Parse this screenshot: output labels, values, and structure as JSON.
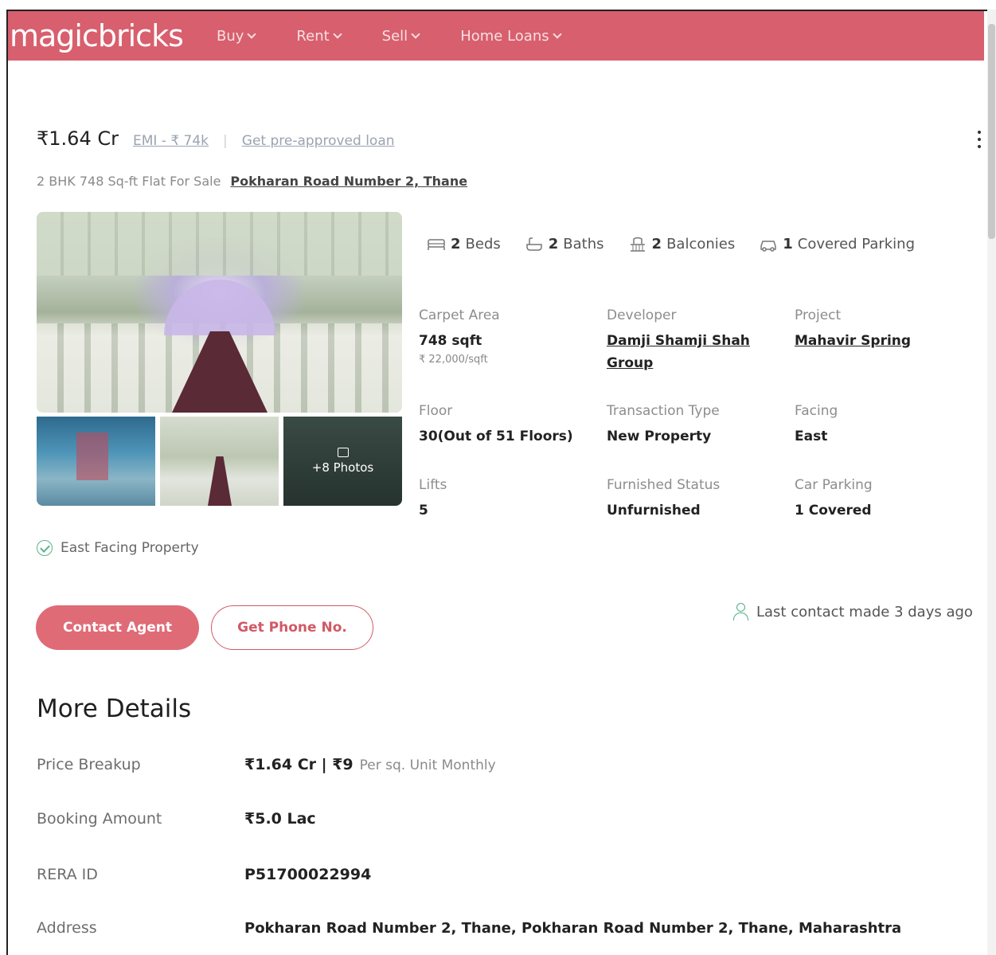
{
  "header": {
    "logo": "magicbricks",
    "nav": [
      {
        "label": "Buy"
      },
      {
        "label": "Rent"
      },
      {
        "label": "Sell"
      },
      {
        "label": "Home Loans"
      }
    ],
    "brand_color": "#d85f6d"
  },
  "listing": {
    "price": "₹1.64 Cr",
    "emi": "EMI - ₹ 74k",
    "separator": "|",
    "loan_link": "Get pre-approved loan",
    "title": "2 BHK 748 Sq-ft Flat For Sale",
    "location": "Pokharan Road Number 2, Thane",
    "photos_more": "+8 Photos"
  },
  "amenities": [
    {
      "count": "2",
      "label": "Beds",
      "icon": "bed-icon"
    },
    {
      "count": "2",
      "label": "Baths",
      "icon": "bath-icon"
    },
    {
      "count": "2",
      "label": "Balconies",
      "icon": "balcony-icon"
    },
    {
      "count": "1",
      "label": "Covered Parking",
      "icon": "car-icon"
    }
  ],
  "facts": {
    "carpet_area": {
      "label": "Carpet Area",
      "value": "748 sqft",
      "sub": "₹ 22,000/sqft"
    },
    "developer": {
      "label": "Developer",
      "value": "Damji Shamji Shah Group"
    },
    "project": {
      "label": "Project",
      "value": "Mahavir Spring"
    },
    "floor": {
      "label": "Floor",
      "value": "30(Out of 51 Floors)"
    },
    "transaction": {
      "label": "Transaction Type",
      "value": "New Property"
    },
    "facing": {
      "label": "Facing",
      "value": "East"
    },
    "lifts": {
      "label": "Lifts",
      "value": "5"
    },
    "furnished": {
      "label": "Furnished Status",
      "value": "Unfurnished"
    },
    "car_parking": {
      "label": "Car Parking",
      "value": "1 Covered"
    }
  },
  "highlight": "East Facing Property",
  "actions": {
    "contact_agent": "Contact Agent",
    "get_phone": "Get Phone No.",
    "last_contact": "Last contact made 3 days ago"
  },
  "more_details": {
    "heading": "More Details",
    "price_breakup": {
      "label": "Price Breakup",
      "value": "₹1.64 Cr | ₹9",
      "note": "Per sq. Unit Monthly"
    },
    "booking_amount": {
      "label": "Booking Amount",
      "value": "₹5.0 Lac"
    },
    "rera_id": {
      "label": "RERA ID",
      "value": "P51700022994"
    },
    "address": {
      "label": "Address",
      "value": "Pokharan Road Number 2, Thane, Pokharan Road Number 2, Thane, Maharashtra"
    }
  }
}
